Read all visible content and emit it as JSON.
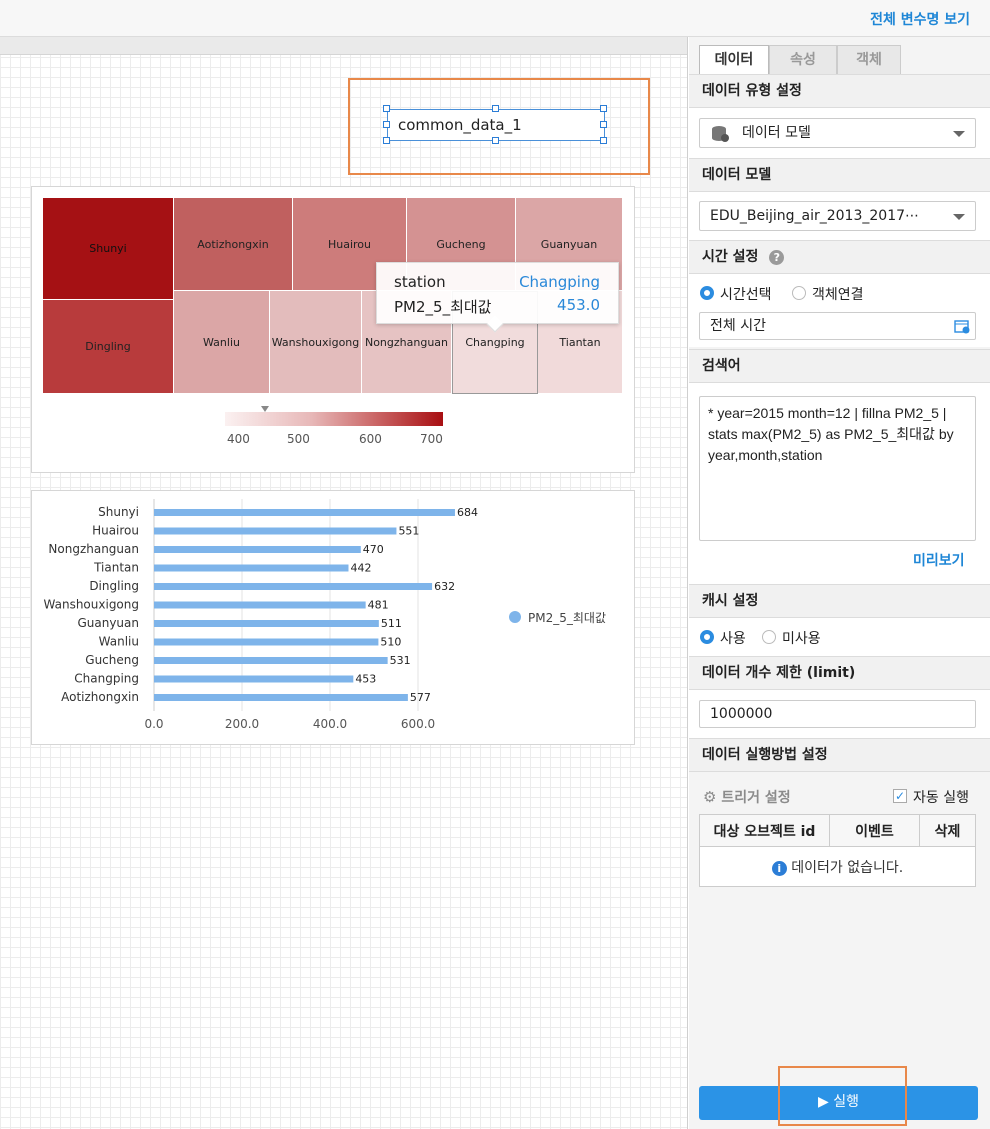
{
  "topbar": {
    "all_vars_link": "전체 변수명 보기"
  },
  "canvas": {
    "label_widget_text": "common_data_1"
  },
  "treemap": {
    "cells": [
      {
        "name": "Shunyi",
        "color": "#a51114"
      },
      {
        "name": "Aotizhongxin",
        "color": "#c0605f"
      },
      {
        "name": "Huairou",
        "color": "#cd7c7b"
      },
      {
        "name": "Gucheng",
        "color": "#d49292"
      },
      {
        "name": "Guanyuan",
        "color": "#dba6a6"
      },
      {
        "name": "Dingling",
        "color": "#b83b3c"
      },
      {
        "name": "Wanliu",
        "color": "#dba6a6"
      },
      {
        "name": "Wanshouxigong",
        "color": "#e3bcbc"
      },
      {
        "name": "Nongzhanguan",
        "color": "#e6c3c3"
      },
      {
        "name": "Changping",
        "color": "#f1dcdc"
      },
      {
        "name": "Tiantan",
        "color": "#f1dada"
      }
    ],
    "tooltip": {
      "station_key": "station",
      "station_value": "Changping",
      "metric_key": "PM2_5_최대값",
      "metric_value": "453.0"
    },
    "legend_ticks": [
      "400",
      "500",
      "600",
      "700"
    ]
  },
  "chart_data": {
    "type": "bar",
    "categories": [
      "Shunyi",
      "Huairou",
      "Nongzhanguan",
      "Tiantan",
      "Dingling",
      "Wanshouxigong",
      "Guanyuan",
      "Wanliu",
      "Gucheng",
      "Changping",
      "Aotizhongxin"
    ],
    "series": [
      {
        "name": "PM2_5_최대값",
        "values": [
          684,
          551,
          470,
          442,
          632,
          481,
          511,
          510,
          531,
          453,
          577
        ]
      }
    ],
    "xlim": [
      0,
      700
    ],
    "x_ticks": [
      "0.0",
      "200.0",
      "400.0",
      "600.0"
    ],
    "legend": "right",
    "grid": true,
    "color": "#7eb4ea"
  },
  "panel": {
    "tabs": [
      "데이터",
      "속성",
      "객체"
    ],
    "data_type_header": "데이터 유형 설정",
    "data_type_value": "데이터 모델",
    "data_model_header": "데이터 모델",
    "data_model_value": "EDU_Beijing_air_2013_2017⋯",
    "time_header": "시간 설정",
    "time_option_select": "시간선택",
    "time_option_link": "객체연결",
    "time_value": "전체 시간",
    "query_header": "검색어",
    "query_text": "* year=2015 month=12 | fillna PM2_5 | stats max(PM2_5) as PM2_5_최대값 by year,month,station",
    "preview_link": "미리보기",
    "cache_header": "캐시 설정",
    "cache_use": "사용",
    "cache_nouse": "미사용",
    "limit_header": "데이터 개수 제한 (limit)",
    "limit_value": "1000000",
    "exec_header": "데이터 실행방법 설정",
    "trigger_label": "트리거 설정",
    "auto_run_label": "자동 실행",
    "table_headers": [
      "대상 오브젝트 id",
      "이벤트",
      "삭제"
    ],
    "no_data_text": "데이터가 없습니다.",
    "run_button": "▶ 실행"
  }
}
